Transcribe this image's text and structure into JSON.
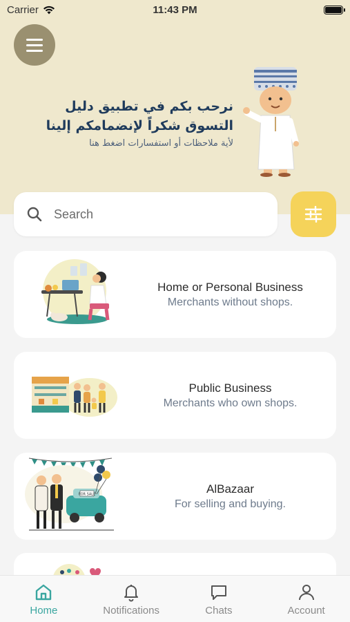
{
  "status_bar": {
    "carrier": "Carrier",
    "time": "11:43 PM"
  },
  "hero": {
    "welcome_line1": "نرحب بكم في تطبيق دليل",
    "welcome_line2": "التسوق شكراً لإنضمامكم إلينا",
    "feedback_link": "لأية ملاحظات أو استفسارات اضغط هنا"
  },
  "search": {
    "placeholder": "Search"
  },
  "categories": [
    {
      "title": "Home or Personal Business",
      "subtitle": "Merchants without shops."
    },
    {
      "title": "Public Business",
      "subtitle": "Merchants who own shops."
    },
    {
      "title": "AlBazaar",
      "subtitle": "For selling and buying."
    }
  ],
  "illustrations": {
    "for_sale_sign": "FOR SALE"
  },
  "tabs": [
    {
      "label": "Home",
      "icon": "home-icon",
      "active": true
    },
    {
      "label": "Notifications",
      "icon": "bell-icon",
      "active": false
    },
    {
      "label": "Chats",
      "icon": "chat-icon",
      "active": false
    },
    {
      "label": "Account",
      "icon": "person-icon",
      "active": false
    }
  ],
  "colors": {
    "hero_bg": "#efe8cd",
    "accent_teal": "#3aa6a0",
    "filter_yellow": "#f5d35a",
    "menu_bg": "#9a9070",
    "title_navy": "#1f3b5c"
  }
}
